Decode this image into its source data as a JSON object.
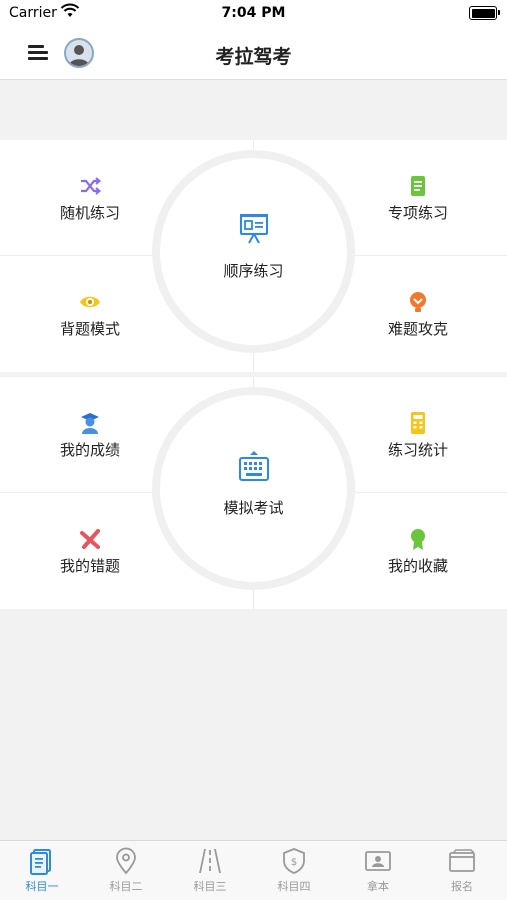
{
  "status_bar": {
    "carrier": "Carrier",
    "time": "7:04 PM"
  },
  "nav": {
    "title": "考拉驾考"
  },
  "section1": {
    "center_label": "顺序练习",
    "top_left": "随机练习",
    "top_right": "专项练习",
    "bottom_left": "背题模式",
    "bottom_right": "难题攻克"
  },
  "section2": {
    "center_label": "模拟考试",
    "top_left": "我的成绩",
    "top_right": "练习统计",
    "bottom_left": "我的错题",
    "bottom_right": "我的收藏"
  },
  "tabs": [
    {
      "label": "科目一",
      "active": true
    },
    {
      "label": "科目二"
    },
    {
      "label": "科目三"
    },
    {
      "label": "科目四"
    },
    {
      "label": "拿本"
    },
    {
      "label": "报名"
    }
  ],
  "colors": {
    "accent": "#2a8be0",
    "inactive": "#999999"
  }
}
